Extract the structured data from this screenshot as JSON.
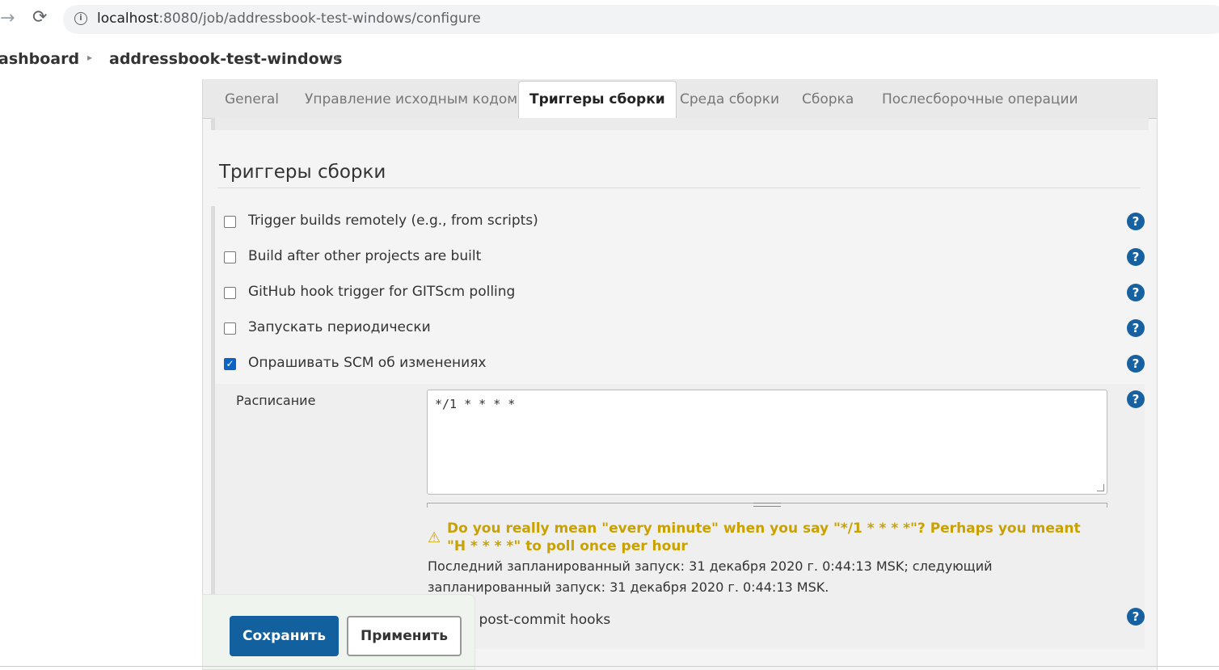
{
  "browser": {
    "url_host": "localhost",
    "url_rest": ":8080/job/addressbook-test-windows/configure",
    "forward_icon": "arrow-right-icon",
    "reload_icon": "reload-icon",
    "info_icon": "info-icon"
  },
  "breadcrumb": {
    "items": [
      "ashboard",
      "addressbook-test-windows"
    ]
  },
  "tabs": [
    {
      "label": "General",
      "active": false
    },
    {
      "label": "Управление исходным кодом",
      "active": false
    },
    {
      "label": "Триггеры сборки",
      "active": true
    },
    {
      "label": "Среда сборки",
      "active": false
    },
    {
      "label": "Сборка",
      "active": false
    },
    {
      "label": "Послесборочные операции",
      "active": false
    }
  ],
  "section": {
    "title": "Триггеры сборки",
    "triggers": [
      {
        "label": "Trigger builds remotely (e.g., from scripts)",
        "checked": false
      },
      {
        "label": "Build after other projects are built",
        "checked": false
      },
      {
        "label": "GitHub hook trigger for GITScm polling",
        "checked": false
      },
      {
        "label": "Запускать периодически",
        "checked": false
      },
      {
        "label": "Опрашивать SCM об изменениях",
        "checked": true
      }
    ],
    "schedule": {
      "label": "Расписание",
      "value": "*/1 * * * *",
      "warning": "Do you really mean \"every minute\" when you say \"*/1 * * * *\"? Perhaps you meant \"H * * * *\" to poll once per hour",
      "info": "Последний запланированный запуск: 31 декабря 2020 г. 0:44:13 MSK; следующий запланированный запуск: 31 декабря 2020 г. 0:44:13 MSK."
    },
    "ignore_hooks_label": "Ignore post-commit hooks",
    "help_glyph": "?"
  },
  "buttons": {
    "save": "Сохранить",
    "apply": "Применить"
  },
  "colors": {
    "primary": "#12619e",
    "help": "#1761a0",
    "warning": "#c9a100",
    "checkbox": "#0b63c4"
  }
}
